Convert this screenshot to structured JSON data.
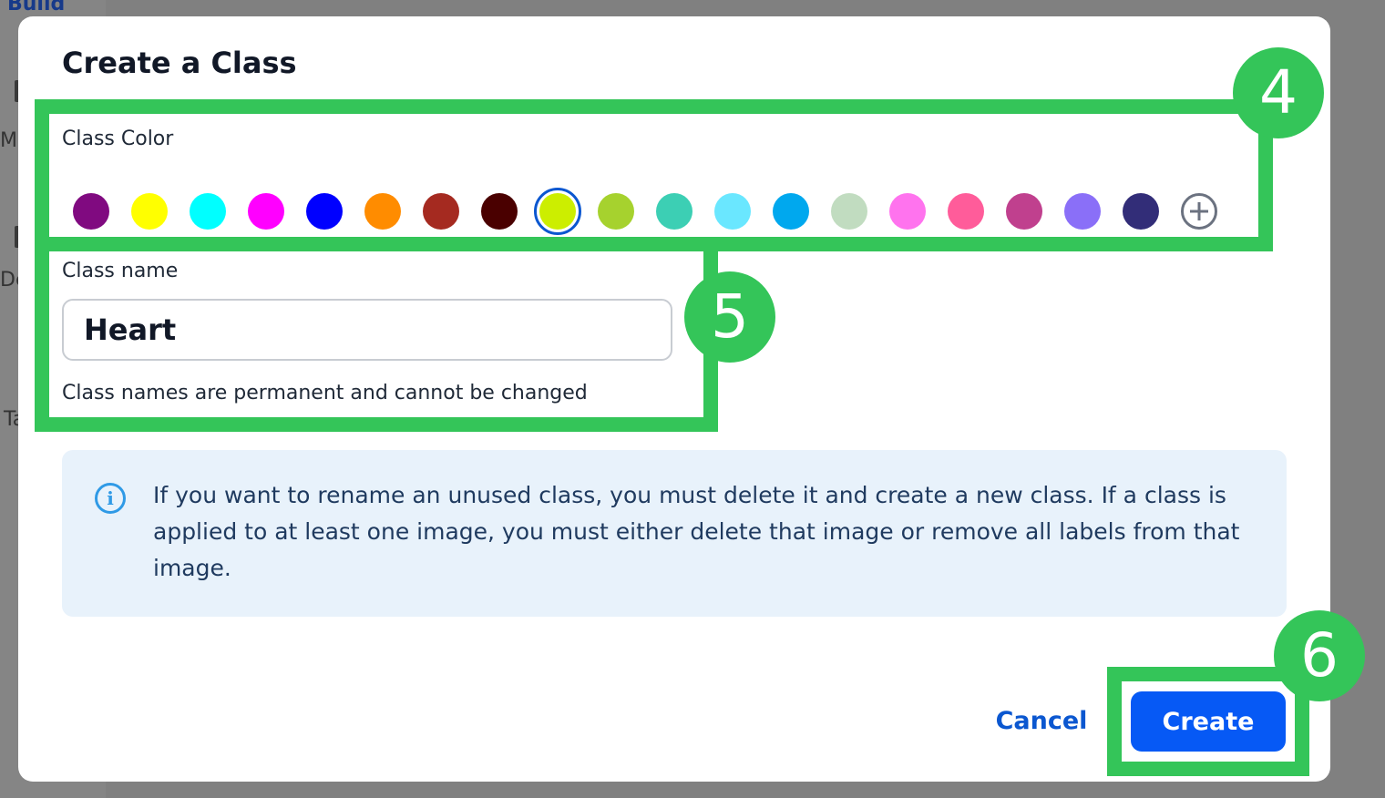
{
  "background": {
    "sidebar_fragments": [
      "Build",
      "Mc",
      "De",
      "Ta"
    ]
  },
  "dialog": {
    "title": "Create a Class",
    "class_color": {
      "label": "Class Color",
      "colors": [
        {
          "hex": "#800a80",
          "selected": false
        },
        {
          "hex": "#ffff00",
          "selected": false
        },
        {
          "hex": "#00ffff",
          "selected": false
        },
        {
          "hex": "#ff00ff",
          "selected": false
        },
        {
          "hex": "#0000ff",
          "selected": false
        },
        {
          "hex": "#ff8c00",
          "selected": false
        },
        {
          "hex": "#a52a20",
          "selected": false
        },
        {
          "hex": "#4a0000",
          "selected": false
        },
        {
          "hex": "#ccee00",
          "selected": true
        },
        {
          "hex": "#a6d22e",
          "selected": false
        },
        {
          "hex": "#3ccfb4",
          "selected": false
        },
        {
          "hex": "#6ae7ff",
          "selected": false
        },
        {
          "hex": "#00a8ee",
          "selected": false
        },
        {
          "hex": "#c1dcc0",
          "selected": false
        },
        {
          "hex": "#ff73ee",
          "selected": false
        },
        {
          "hex": "#ff5c9a",
          "selected": false
        },
        {
          "hex": "#c0408e",
          "selected": false
        },
        {
          "hex": "#8a6ff8",
          "selected": false
        },
        {
          "hex": "#322d78",
          "selected": false
        }
      ],
      "add_icon": "plus-circle-icon"
    },
    "class_name": {
      "label": "Class name",
      "value": "Heart",
      "hint": "Class names are permanent and cannot be changed"
    },
    "info": {
      "icon": "info-icon",
      "icon_glyph": "i",
      "text": "If you want to rename an unused class, you must delete it and create a new class. If a class is applied to at least one image, you must either delete that image or remove all labels from that image."
    },
    "actions": {
      "cancel_label": "Cancel",
      "create_label": "Create"
    }
  },
  "annotations": {
    "badge_4": "4",
    "badge_5": "5",
    "badge_6": "6",
    "color": "#34c559"
  }
}
